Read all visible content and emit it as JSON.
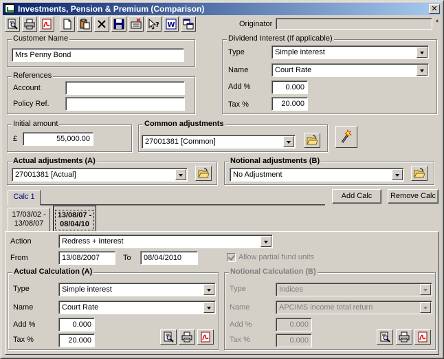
{
  "window": {
    "title": "Investments, Pension & Premium (Comparison)",
    "close_glyph": "✕"
  },
  "toolbar": {
    "icons": [
      "print-preview-icon",
      "print-icon",
      "pdf-icon",
      "new-document-icon",
      "paste-icon",
      "delete-icon",
      "save-icon",
      "clear-icon",
      "help-icon",
      "word-icon",
      "copy-windows-icon"
    ]
  },
  "originator": {
    "label": "Originator",
    "value": "",
    "asterisk": "*"
  },
  "customer": {
    "group_label": "Customer Name",
    "name": "Mrs Penny Bond"
  },
  "references": {
    "group_label": "References",
    "account_label": "Account",
    "account_value": "",
    "policy_label": "Policy Ref.",
    "policy_value": ""
  },
  "dividend": {
    "group_label": "Dividend Interest (If applicable)",
    "type_label": "Type",
    "type_value": "Simple interest",
    "name_label": "Name",
    "name_value": "Court Rate",
    "add_label": "Add %",
    "add_value": "0.000",
    "tax_label": "Tax %",
    "tax_value": "20.000"
  },
  "initial": {
    "group_label": "Initial amount",
    "currency": "£",
    "value": "55,000.00"
  },
  "common": {
    "group_label": "Common adjustments",
    "value": "27001381 [Common]"
  },
  "actual_adj": {
    "group_label": "Actual adjustments (A)",
    "value": "27001381 [Actual]"
  },
  "notional_adj": {
    "group_label": "Notional adjustments (B)",
    "value": "No Adjustment"
  },
  "calc": {
    "tab_label": "Calc 1",
    "add_button": "Add Calc",
    "remove_button": "Remove Calc",
    "periods": [
      {
        "line1": "17/03/02 -",
        "line2": "13/08/07"
      },
      {
        "line1": "13/08/07 -",
        "line2": "08/04/10"
      }
    ],
    "action_label": "Action",
    "action_value": "Redress + interest",
    "from_label": "From",
    "from_value": "13/08/2007",
    "to_label": "To",
    "to_value": "08/04/2010",
    "partial_label": "Allow partial fund units"
  },
  "actual_calc": {
    "group_label": "Actual Calculation (A)",
    "type_label": "Type",
    "type_value": "Simple interest",
    "name_label": "Name",
    "name_value": "Court Rate",
    "add_label": "Add %",
    "add_value": "0.000",
    "tax_label": "Tax %",
    "tax_value": "20.000"
  },
  "notional_calc": {
    "group_label": "Notional Calculation (B)",
    "type_label": "Type",
    "type_value": "Indices",
    "name_label": "Name",
    "name_value": "APCIMS income total return",
    "add_label": "Add %",
    "add_value": "0.000",
    "tax_label": "Tax %",
    "tax_value": "0.000"
  },
  "colors": {
    "titlebar_start": "#0a246a",
    "titlebar_end": "#a6caf0",
    "face": "#d4d0c8"
  }
}
